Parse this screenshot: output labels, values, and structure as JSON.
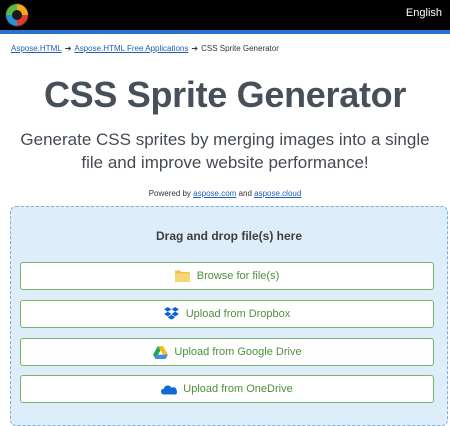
{
  "header": {
    "language": "English",
    "colors": {
      "bar": "#000000",
      "accent_line": "#2b73c9"
    }
  },
  "breadcrumb": {
    "items": [
      "Aspose.HTML",
      "Aspose.HTML Free Applications",
      "CSS Sprite Generator"
    ]
  },
  "main": {
    "title": "CSS Sprite Generator",
    "subtitle": "Generate CSS sprites by merging images into a single file and improve website performance!",
    "powered_prefix": "Powered by",
    "powered_link1": "aspose.com",
    "powered_and": "and",
    "powered_link2": "aspose.cloud"
  },
  "dropzone": {
    "label": "Drag and drop file(s) here",
    "buttons": [
      {
        "label": "Browse for file(s)",
        "icon": "folder-icon"
      },
      {
        "label": "Upload from Dropbox",
        "icon": "dropbox-icon"
      },
      {
        "label": "Upload from Google Drive",
        "icon": "google-drive-icon"
      },
      {
        "label": "Upload from OneDrive",
        "icon": "onedrive-icon"
      }
    ],
    "colors": {
      "background": "#ddeefa",
      "button_text": "#4f8e3d",
      "button_border": "#79b36d"
    }
  }
}
